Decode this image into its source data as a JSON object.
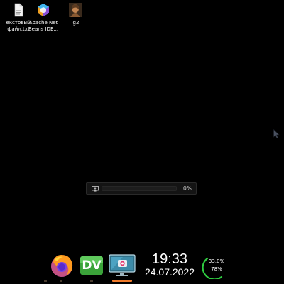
{
  "desktop": {
    "icons": [
      {
        "label": "екстовый\nфайл.txt",
        "icon": "text-file-icon"
      },
      {
        "label": "Apache Net\nBeans IDE...",
        "icon": "netbeans-icon"
      },
      {
        "label": "ig2",
        "icon": "image-thumbnail-icon"
      }
    ]
  },
  "progress_dialog": {
    "percent_label": "0%",
    "progress": 0,
    "icon": "monitor-icon",
    "accent_color": "#3daee9"
  },
  "taskbar": {
    "apps": [
      {
        "name": "Firefox",
        "icon": "firefox-icon"
      },
      {
        "name": "DV",
        "label": "DV",
        "icon": "dv-icon"
      },
      {
        "name": "Screenshot tool",
        "icon": "screenshot-app-icon",
        "active": true
      }
    ],
    "clock": {
      "time": "19:33",
      "date": "24.07.2022"
    },
    "system_monitor": {
      "top_value": "33,0%",
      "bottom_value": "78%",
      "ring_color": "#2ecc40"
    },
    "active_indicator_color": "#f07a2a"
  }
}
